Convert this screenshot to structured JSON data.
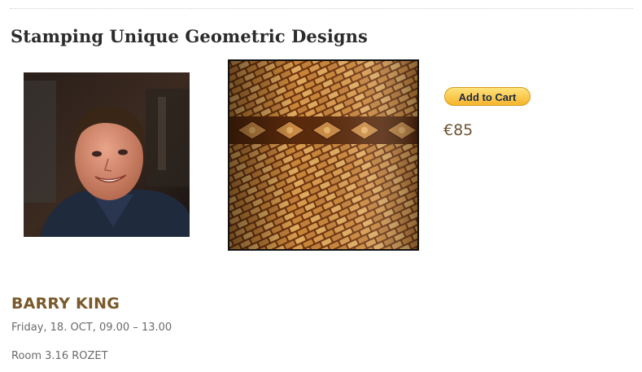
{
  "workshop": {
    "title": "Stamping Unique Geometric Designs",
    "instructor_photo": "instructor-portrait-image",
    "craft_image": "tooled-leather-basketweave-image"
  },
  "purchase": {
    "add_to_cart_label": "Add to Cart",
    "price": "€85"
  },
  "instructor": {
    "name": "BARRY KING",
    "schedule": "Friday, 18. OCT, 09.00 – 13.00",
    "room": "Room 3.16 ROZET"
  },
  "colors": {
    "title": "#2b2b2b",
    "name_accent": "#7a5a2a",
    "price": "#6b5230",
    "button_top": "#ffe27a",
    "button_bottom": "#f7b52c"
  }
}
